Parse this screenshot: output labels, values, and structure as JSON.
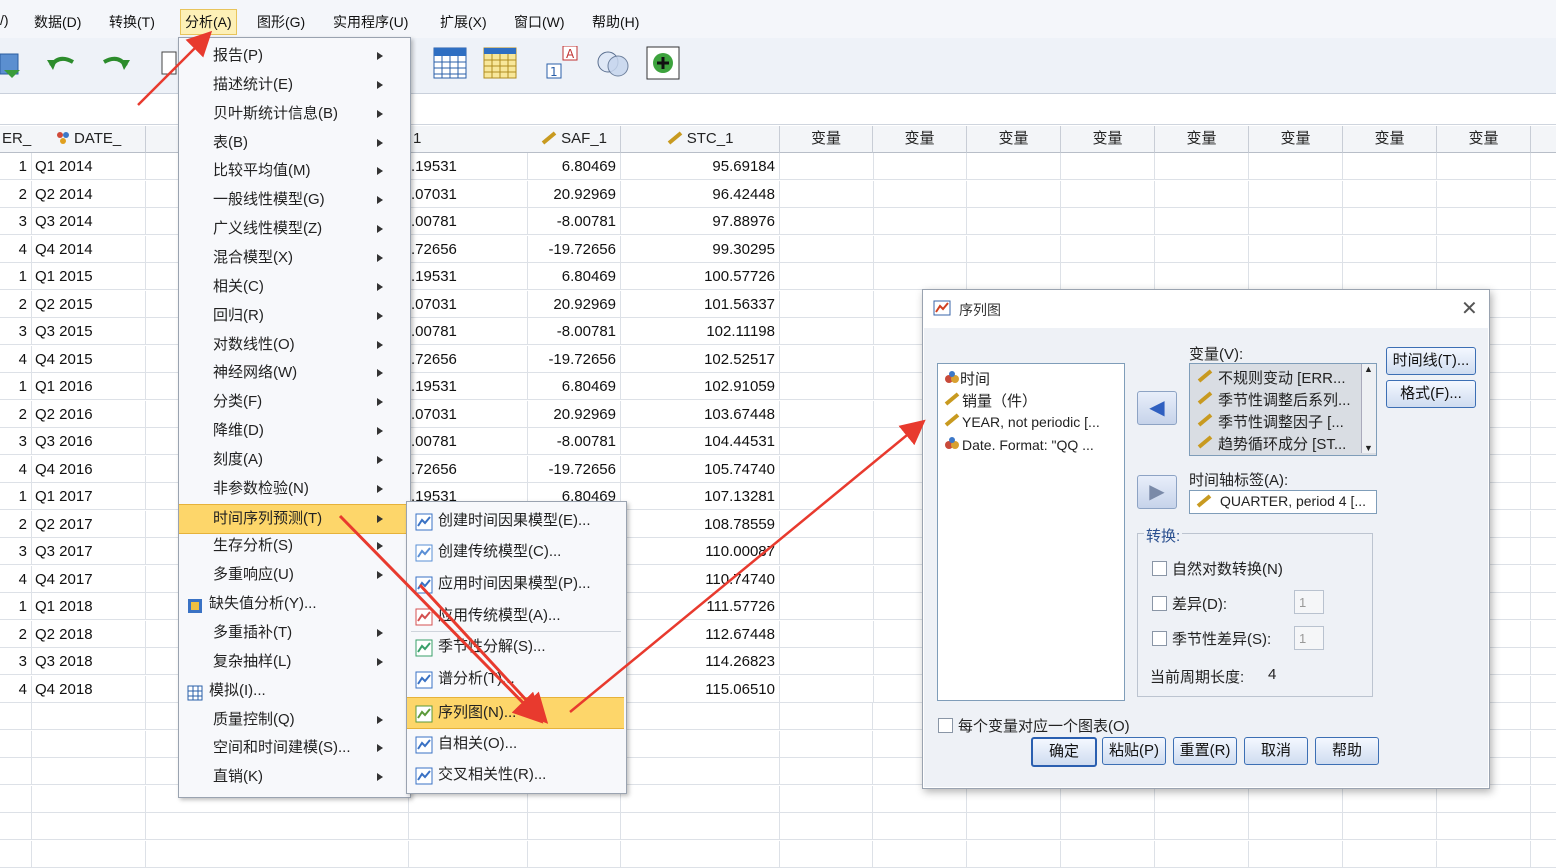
{
  "menubar": {
    "items": [
      "/)",
      "数据(D)",
      "转换(T)",
      "分析(A)",
      "图形(G)",
      "实用程序(U)",
      "扩展(X)",
      "窗口(W)",
      "帮助(H)"
    ]
  },
  "grid": {
    "headers": [
      "ER_",
      "DATE_",
      "1",
      "SAF_1",
      "STC_1",
      "变量",
      "变量",
      "变量",
      "变量",
      "变量",
      "变量",
      "变量",
      "变量"
    ],
    "rows": [
      {
        "er": "1",
        "date": "Q1 2014",
        "c1": ".19531",
        "saf": "6.80469",
        "stc": "95.69184"
      },
      {
        "er": "2",
        "date": "Q2 2014",
        "c1": ".07031",
        "saf": "20.92969",
        "stc": "96.42448"
      },
      {
        "er": "3",
        "date": "Q3 2014",
        "c1": ".00781",
        "saf": "-8.00781",
        "stc": "97.88976"
      },
      {
        "er": "4",
        "date": "Q4 2014",
        "c1": ".72656",
        "saf": "-19.72656",
        "stc": "99.30295"
      },
      {
        "er": "1",
        "date": "Q1 2015",
        "c1": ".19531",
        "saf": "6.80469",
        "stc": "100.57726"
      },
      {
        "er": "2",
        "date": "Q2 2015",
        "c1": ".07031",
        "saf": "20.92969",
        "stc": "101.56337"
      },
      {
        "er": "3",
        "date": "Q3 2015",
        "c1": ".00781",
        "saf": "-8.00781",
        "stc": "102.11198"
      },
      {
        "er": "4",
        "date": "Q4 2015",
        "c1": ".72656",
        "saf": "-19.72656",
        "stc": "102.52517"
      },
      {
        "er": "1",
        "date": "Q1 2016",
        "c1": ".19531",
        "saf": "6.80469",
        "stc": "102.91059"
      },
      {
        "er": "2",
        "date": "Q2 2016",
        "c1": ".07031",
        "saf": "20.92969",
        "stc": "103.67448"
      },
      {
        "er": "3",
        "date": "Q3 2016",
        "c1": ".00781",
        "saf": "-8.00781",
        "stc": "104.44531"
      },
      {
        "er": "4",
        "date": "Q4 2016",
        "c1": ".72656",
        "saf": "-19.72656",
        "stc": "105.74740"
      },
      {
        "er": "1",
        "date": "Q1 2017",
        "c1": ".19531",
        "saf": "6.80469",
        "stc": "107.13281"
      },
      {
        "er": "2",
        "date": "Q2 2017",
        "c1": "",
        "saf": "",
        "stc": "108.78559"
      },
      {
        "er": "3",
        "date": "Q3 2017",
        "c1": "",
        "saf": "",
        "stc": "110.00087"
      },
      {
        "er": "4",
        "date": "Q4 2017",
        "c1": "",
        "saf": "",
        "stc": "110.74740"
      },
      {
        "er": "1",
        "date": "Q1 2018",
        "c1": "",
        "saf": "",
        "stc": "111.57726"
      },
      {
        "er": "2",
        "date": "Q2 2018",
        "c1": "",
        "saf": "",
        "stc": "112.67448"
      },
      {
        "er": "3",
        "date": "Q3 2018",
        "c1": "",
        "saf": "",
        "stc": "114.26823"
      },
      {
        "er": "4",
        "date": "Q4 2018",
        "c1": "",
        "saf": "",
        "stc": "115.06510"
      }
    ]
  },
  "analyze_menu": {
    "items": [
      {
        "label": "报告(P)",
        "submenu": true
      },
      {
        "label": "描述统计(E)",
        "submenu": true
      },
      {
        "label": "贝叶斯统计信息(B)",
        "submenu": true
      },
      {
        "label": "表(B)",
        "submenu": true
      },
      {
        "label": "比较平均值(M)",
        "submenu": true
      },
      {
        "label": "一般线性模型(G)",
        "submenu": true
      },
      {
        "label": "广义线性模型(Z)",
        "submenu": true
      },
      {
        "label": "混合模型(X)",
        "submenu": true
      },
      {
        "label": "相关(C)",
        "submenu": true
      },
      {
        "label": "回归(R)",
        "submenu": true
      },
      {
        "label": "对数线性(O)",
        "submenu": true
      },
      {
        "label": "神经网络(W)",
        "submenu": true
      },
      {
        "label": "分类(F)",
        "submenu": true
      },
      {
        "label": "降维(D)",
        "submenu": true
      },
      {
        "label": "刻度(A)",
        "submenu": true
      },
      {
        "label": "非参数检验(N)",
        "submenu": true
      },
      {
        "label": "时间序列预测(T)",
        "submenu": true,
        "highlighted": true
      },
      {
        "label": "生存分析(S)",
        "submenu": true
      },
      {
        "label": "多重响应(U)",
        "submenu": true
      },
      {
        "label": "缺失值分析(Y)...",
        "submenu": false,
        "icon": "missing-values-icon"
      },
      {
        "label": "多重插补(T)",
        "submenu": true
      },
      {
        "label": "复杂抽样(L)",
        "submenu": true
      },
      {
        "label": "模拟(I)...",
        "submenu": false,
        "icon": "simulation-icon"
      },
      {
        "label": "质量控制(Q)",
        "submenu": true
      },
      {
        "label": "空间和时间建模(S)...",
        "submenu": true
      },
      {
        "label": "直销(K)",
        "submenu": true
      }
    ]
  },
  "timeseries_submenu": {
    "items": [
      {
        "label": "创建时间因果模型(E)...",
        "icon": "temporal-causal-icon"
      },
      {
        "label": "创建传统模型(C)...",
        "icon": "traditional-model-icon"
      },
      {
        "label": "应用时间因果模型(P)...",
        "icon": "apply-temporal-causal-icon"
      },
      {
        "label": "应用传统模型(A)...",
        "icon": "apply-traditional-icon"
      },
      {
        "label": "季节性分解(S)...",
        "icon": "seasonal-decomposition-icon"
      },
      {
        "label": "谱分析(T)...",
        "icon": "spectral-analysis-icon"
      },
      {
        "label": "序列图(N)...",
        "icon": "sequence-chart-icon",
        "highlighted": true
      },
      {
        "label": "自相关(O)...",
        "icon": "autocorrelation-icon"
      },
      {
        "label": "交叉相关性(R)...",
        "icon": "cross-correlation-icon"
      }
    ]
  },
  "dialog": {
    "title": "序列图",
    "source_vars": [
      "时间",
      "销量（件）",
      "YEAR, not periodic [...",
      "Date.  Format:  \"QQ ..."
    ],
    "variables_label": "变量(V):",
    "variables": [
      "不规则变动 [ERR...",
      "季节性调整后系列...",
      "季节性调整因子 [...",
      "趋势循环成分 [ST..."
    ],
    "time_axis_label": "时间轴标签(A):",
    "time_axis_value": "QUARTER, period 4 [...",
    "time_lines_button": "时间线(T)...",
    "format_button": "格式(F)...",
    "transform_group": "转换:",
    "natural_log": "自然对数转换(N)",
    "difference": "差异(D):",
    "difference_value": "1",
    "seasonal_difference": "季节性差异(S):",
    "seasonal_difference_value": "1",
    "current_period_label": "当前周期长度:",
    "current_period_value": "4",
    "one_chart_per_var": "每个变量对应一个图表(O)",
    "buttons": {
      "ok": "确定",
      "paste": "粘贴(P)",
      "reset": "重置(R)",
      "cancel": "取消",
      "help": "帮助"
    }
  },
  "colors": {
    "annotation_arrow": "#e83a2e",
    "highlight": "#fdd66a"
  }
}
